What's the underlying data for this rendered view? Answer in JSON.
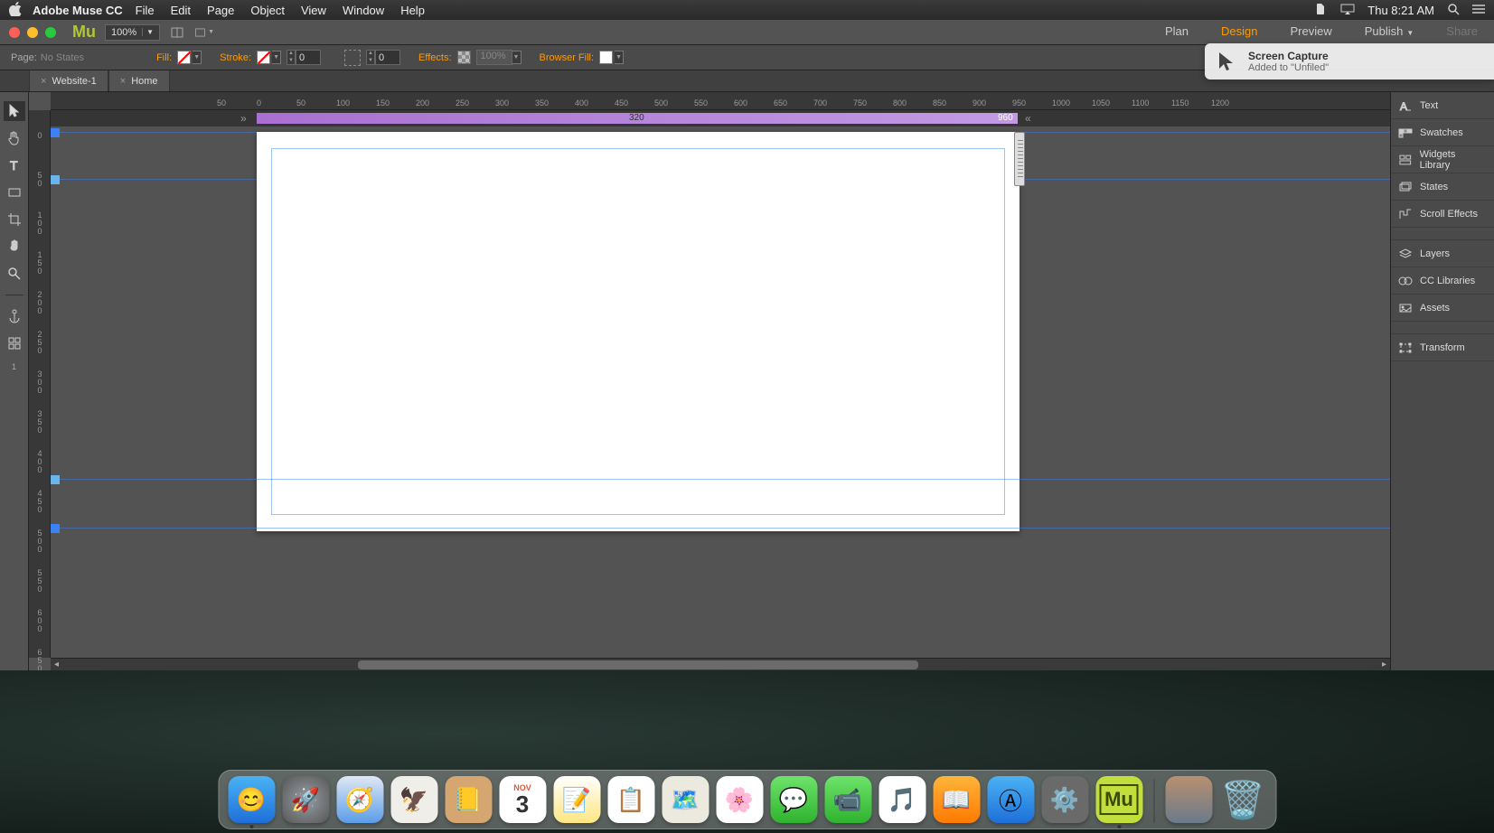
{
  "menubar": {
    "app": "Adobe Muse CC",
    "items": [
      "File",
      "Edit",
      "Page",
      "Object",
      "View",
      "Window",
      "Help"
    ],
    "clock": "Thu 8:21 AM"
  },
  "appbar": {
    "logo": "Mu",
    "zoom": "100%",
    "modes": [
      "Plan",
      "Design",
      "Preview",
      "Publish",
      "Share"
    ],
    "active_mode": "Design"
  },
  "controlbar": {
    "page_label": "Page:",
    "page_value": "No States",
    "fill_label": "Fill:",
    "stroke_label": "Stroke:",
    "stroke_val": "0",
    "corner_val": "0",
    "effects_label": "Effects:",
    "opacity": "100%",
    "browserfill_label": "Browser Fill:"
  },
  "tabs": [
    {
      "label": "Website-1"
    },
    {
      "label": "Home"
    }
  ],
  "ruler_h_ticks": [
    "50",
    "0",
    "50",
    "100",
    "150",
    "200",
    "250",
    "300",
    "350",
    "400",
    "450",
    "500",
    "550",
    "600",
    "650",
    "700",
    "750",
    "800",
    "850",
    "900",
    "950",
    "1000",
    "1050",
    "1100",
    "1150",
    "1200"
  ],
  "ruler_v_ticks": [
    "0",
    "50",
    "100",
    "150",
    "200",
    "250",
    "300",
    "350",
    "400",
    "450",
    "500",
    "550",
    "600",
    "650"
  ],
  "breakpoints": {
    "label_min": "320",
    "label_max": "960"
  },
  "tools": [
    "pointer",
    "hand-grab",
    "text",
    "rect",
    "crop",
    "pan",
    "zoom",
    "anchor",
    "align"
  ],
  "panels": {
    "group1": [
      "Text",
      "Swatches",
      "Widgets Library",
      "States",
      "Scroll Effects"
    ],
    "group2": [
      "Layers",
      "CC Libraries",
      "Assets"
    ],
    "group3": [
      "Transform"
    ]
  },
  "notification": {
    "title": "Screen Capture",
    "subtitle": "Added to \"Unfiled\""
  },
  "dock": {
    "apps": [
      {
        "name": "finder",
        "bg": "linear-gradient(#4ab3f4,#1e6fd9)",
        "glyph": "😊"
      },
      {
        "name": "launchpad",
        "bg": "radial-gradient(#9aa0a6,#555)",
        "glyph": "🚀"
      },
      {
        "name": "safari",
        "bg": "linear-gradient(#e0e8f4,#5a9de8)",
        "glyph": "🧭"
      },
      {
        "name": "mail",
        "bg": "#efeee9",
        "glyph": "🦅"
      },
      {
        "name": "contacts",
        "bg": "#d6a671",
        "glyph": "📒"
      },
      {
        "name": "calendar",
        "bg": "#fff",
        "glyph": "📅"
      },
      {
        "name": "notes",
        "bg": "linear-gradient(#fff,#ffe680)",
        "glyph": "📝"
      },
      {
        "name": "reminders",
        "bg": "#fff",
        "glyph": "📋"
      },
      {
        "name": "maps",
        "bg": "#eceadf",
        "glyph": "🗺️"
      },
      {
        "name": "photos",
        "bg": "#fff",
        "glyph": "🌸"
      },
      {
        "name": "messages",
        "bg": "linear-gradient(#6ee36b,#2fb32f)",
        "glyph": "💬"
      },
      {
        "name": "facetime",
        "bg": "linear-gradient(#6ee36b,#2fb32f)",
        "glyph": "📹"
      },
      {
        "name": "itunes",
        "bg": "#fff",
        "glyph": "🎵"
      },
      {
        "name": "ibooks",
        "bg": "linear-gradient(#ffb43a,#ff7a00)",
        "glyph": "📖"
      },
      {
        "name": "appstore",
        "bg": "linear-gradient(#4ab3f4,#1e6fd9)",
        "glyph": "Ⓐ"
      },
      {
        "name": "preferences",
        "bg": "#6a6a6a",
        "glyph": "⚙️"
      },
      {
        "name": "muse",
        "bg": "#c2de3d",
        "glyph": "Mu"
      }
    ],
    "right": [
      {
        "name": "desktop-pic",
        "bg": "linear-gradient(#b89070,#6a7a8a)",
        "glyph": ""
      },
      {
        "name": "trash",
        "bg": "transparent",
        "glyph": "🗑️"
      }
    ],
    "cal_month": "NOV",
    "cal_day": "3"
  }
}
